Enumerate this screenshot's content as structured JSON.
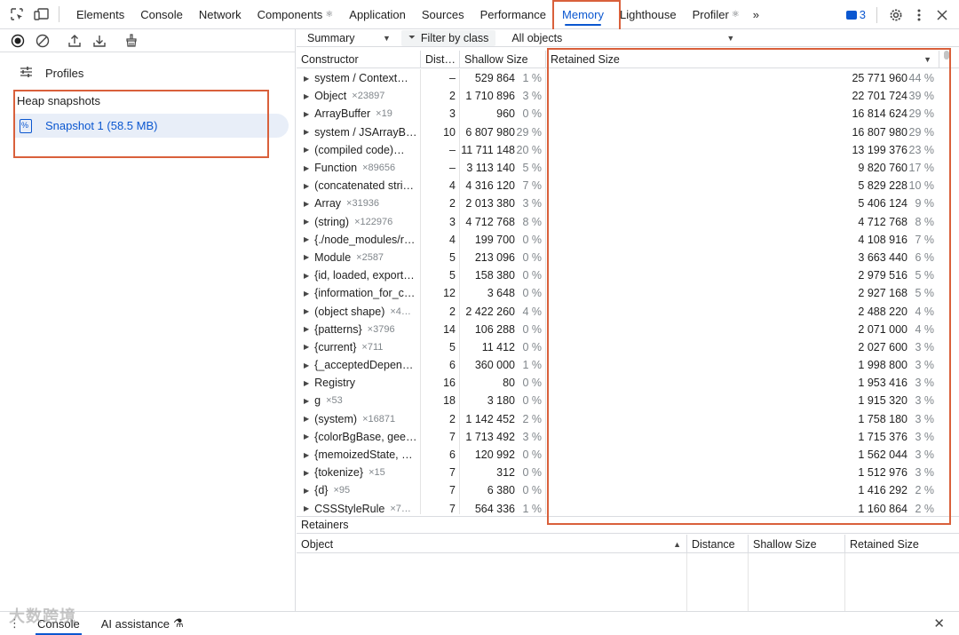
{
  "tabbar": {
    "tabs": [
      {
        "label": "Elements",
        "mark": ""
      },
      {
        "label": "Console",
        "mark": ""
      },
      {
        "label": "Network",
        "mark": ""
      },
      {
        "label": "Components",
        "mark": "⚛"
      },
      {
        "label": "Application",
        "mark": ""
      },
      {
        "label": "Sources",
        "mark": ""
      },
      {
        "label": "Performance",
        "mark": ""
      },
      {
        "label": "Memory",
        "mark": ""
      },
      {
        "label": "Lighthouse",
        "mark": ""
      },
      {
        "label": "Profiler",
        "mark": "⚛"
      }
    ],
    "more_label": "»",
    "issues_count": "3",
    "accent_color": "#0b57d0"
  },
  "leftpanel": {
    "profiles_label": "Profiles",
    "heap_title": "Heap snapshots",
    "snapshot_label": "Snapshot 1 (58.5 MB)"
  },
  "toolbar": {
    "view_label": "Summary",
    "filter_label": "Filter by class",
    "objects_label": "All objects"
  },
  "grid": {
    "headers": {
      "constructor": "Constructor",
      "distance": "Dist…",
      "shallow": "Shallow Size",
      "retained": "Retained Size"
    },
    "rows": [
      {
        "name": "system / Context…",
        "count": "",
        "dist": "–",
        "shallow": "529 864",
        "shallow_pct": "1 %",
        "retained": "25 771 960",
        "retained_pct": "44 %"
      },
      {
        "name": "Object",
        "count": "×23897",
        "dist": "2",
        "shallow": "1 710 896",
        "shallow_pct": "3 %",
        "retained": "22 701 724",
        "retained_pct": "39 %"
      },
      {
        "name": "ArrayBuffer",
        "count": "×19",
        "dist": "3",
        "shallow": "960",
        "shallow_pct": "0 %",
        "retained": "16 814 624",
        "retained_pct": "29 %"
      },
      {
        "name": "system / JSArrayB…",
        "count": "",
        "dist": "10",
        "shallow": "6 807 980",
        "shallow_pct": "29 %",
        "retained": "16 807 980",
        "retained_pct": "29 %"
      },
      {
        "name": "(compiled code)…",
        "count": "",
        "dist": "–",
        "shallow": "11 711 148",
        "shallow_pct": "20 %",
        "retained": "13 199 376",
        "retained_pct": "23 %"
      },
      {
        "name": "Function",
        "count": "×89656",
        "dist": "–",
        "shallow": "3 113 140",
        "shallow_pct": "5 %",
        "retained": "9 820 760",
        "retained_pct": "17 %"
      },
      {
        "name": "(concatenated stri…",
        "count": "",
        "dist": "4",
        "shallow": "4 316 120",
        "shallow_pct": "7 %",
        "retained": "5 829 228",
        "retained_pct": "10 %"
      },
      {
        "name": "Array",
        "count": "×31936",
        "dist": "2",
        "shallow": "2 013 380",
        "shallow_pct": "3 %",
        "retained": "5 406 124",
        "retained_pct": "9 %"
      },
      {
        "name": "(string)",
        "count": "×122976",
        "dist": "3",
        "shallow": "4 712 768",
        "shallow_pct": "8 %",
        "retained": "4 712 768",
        "retained_pct": "8 %"
      },
      {
        "name": "{./node_modules/r…",
        "count": "",
        "dist": "4",
        "shallow": "199 700",
        "shallow_pct": "0 %",
        "retained": "4 108 916",
        "retained_pct": "7 %"
      },
      {
        "name": "Module",
        "count": "×2587",
        "dist": "5",
        "shallow": "213 096",
        "shallow_pct": "0 %",
        "retained": "3 663 440",
        "retained_pct": "6 %"
      },
      {
        "name": "{id, loaded, export…",
        "count": "",
        "dist": "5",
        "shallow": "158 380",
        "shallow_pct": "0 %",
        "retained": "2 979 516",
        "retained_pct": "5 %"
      },
      {
        "name": "{information_for_c…",
        "count": "",
        "dist": "12",
        "shallow": "3 648",
        "shallow_pct": "0 %",
        "retained": "2 927 168",
        "retained_pct": "5 %"
      },
      {
        "name": "(object shape)",
        "count": "×4…",
        "dist": "2",
        "shallow": "2 422 260",
        "shallow_pct": "4 %",
        "retained": "2 488 220",
        "retained_pct": "4 %"
      },
      {
        "name": "{patterns}",
        "count": "×3796",
        "dist": "14",
        "shallow": "106 288",
        "shallow_pct": "0 %",
        "retained": "2 071 000",
        "retained_pct": "4 %"
      },
      {
        "name": "{current}",
        "count": "×711",
        "dist": "5",
        "shallow": "11 412",
        "shallow_pct": "0 %",
        "retained": "2 027 600",
        "retained_pct": "3 %"
      },
      {
        "name": "{_acceptedDepen…",
        "count": "",
        "dist": "6",
        "shallow": "360 000",
        "shallow_pct": "1 %",
        "retained": "1 998 800",
        "retained_pct": "3 %"
      },
      {
        "name": "Registry",
        "count": "",
        "dist": "16",
        "shallow": "80",
        "shallow_pct": "0 %",
        "retained": "1 953 416",
        "retained_pct": "3 %"
      },
      {
        "name": "g",
        "count": "×53",
        "dist": "18",
        "shallow": "3 180",
        "shallow_pct": "0 %",
        "retained": "1 915 320",
        "retained_pct": "3 %"
      },
      {
        "name": "(system)",
        "count": "×16871",
        "dist": "2",
        "shallow": "1 142 452",
        "shallow_pct": "2 %",
        "retained": "1 758 180",
        "retained_pct": "3 %"
      },
      {
        "name": "{colorBgBase, gee…",
        "count": "",
        "dist": "7",
        "shallow": "1 713 492",
        "shallow_pct": "3 %",
        "retained": "1 715 376",
        "retained_pct": "3 %"
      },
      {
        "name": "{memoizedState, …",
        "count": "",
        "dist": "6",
        "shallow": "120 992",
        "shallow_pct": "0 %",
        "retained": "1 562 044",
        "retained_pct": "3 %"
      },
      {
        "name": "{tokenize}",
        "count": "×15",
        "dist": "7",
        "shallow": "312",
        "shallow_pct": "0 %",
        "retained": "1 512 976",
        "retained_pct": "3 %"
      },
      {
        "name": "{d}",
        "count": "×95",
        "dist": "7",
        "shallow": "6 380",
        "shallow_pct": "0 %",
        "retained": "1 416 292",
        "retained_pct": "2 %"
      },
      {
        "name": "CSSStyleRule",
        "count": "×7…",
        "dist": "7",
        "shallow": "564 336",
        "shallow_pct": "1 %",
        "retained": "1 160 864",
        "retained_pct": "2 %"
      }
    ]
  },
  "retainers": {
    "title": "Retainers",
    "headers": {
      "object": "Object",
      "distance": "Distance",
      "shallow": "Shallow Size",
      "retained": "Retained Size"
    }
  },
  "drawer": {
    "tabs": [
      "Console",
      "AI assistance"
    ],
    "close_label": "✕"
  },
  "watermark": "大数跨境",
  "highlight_color": "#d9603b"
}
